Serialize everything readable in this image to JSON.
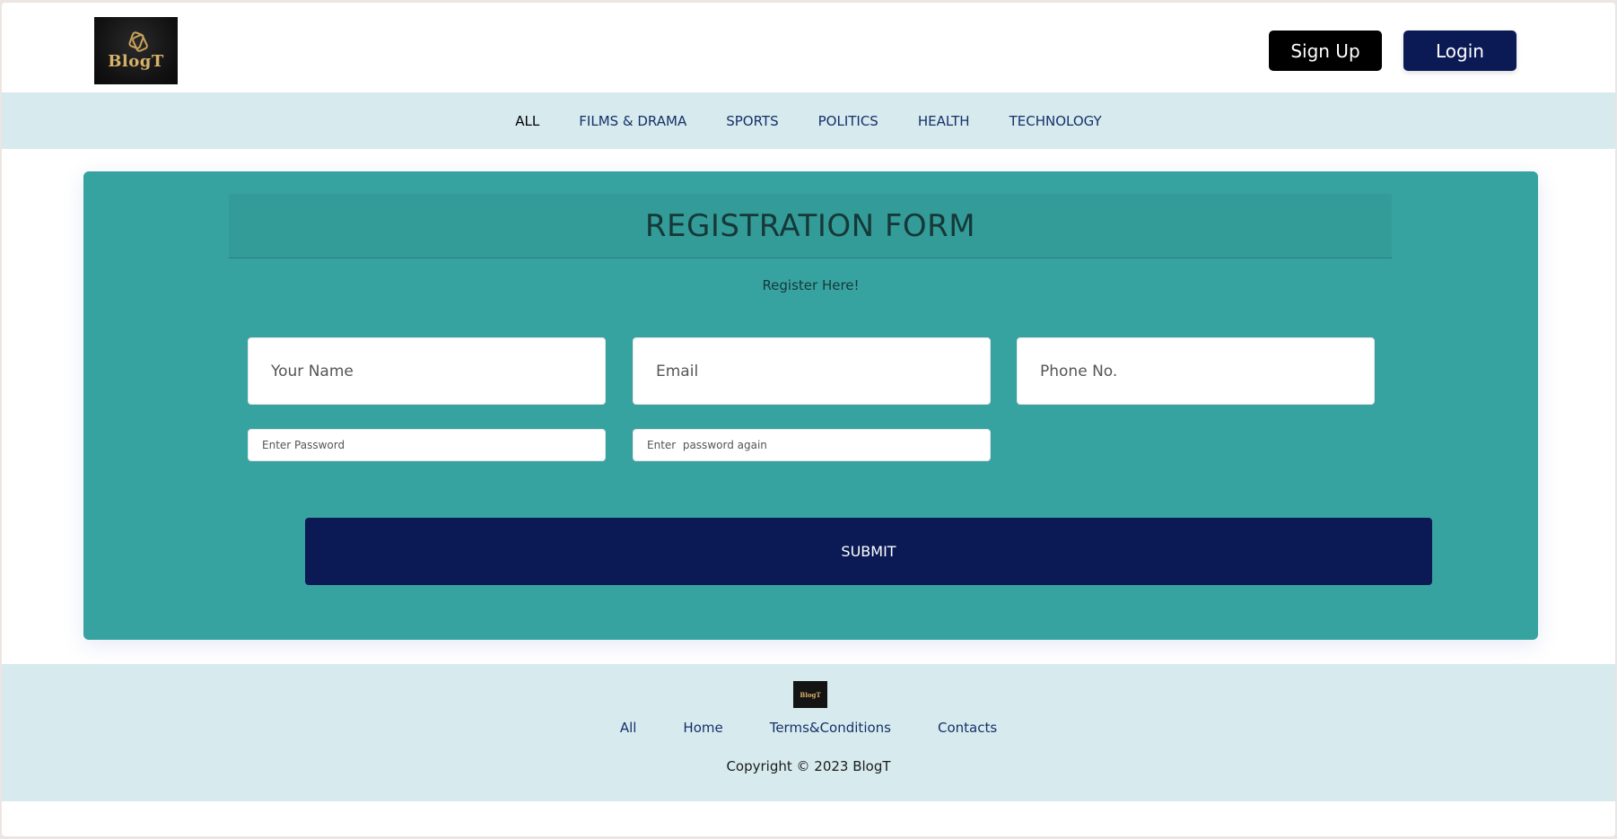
{
  "header": {
    "logo_text": "BlogT",
    "signup_label": "Sign Up",
    "login_label": "Login"
  },
  "nav": {
    "items": [
      {
        "label": "ALL",
        "active": true
      },
      {
        "label": "FILMS & DRAMA",
        "active": false
      },
      {
        "label": "SPORTS",
        "active": false
      },
      {
        "label": "POLITICS",
        "active": false
      },
      {
        "label": "HEALTH",
        "active": false
      },
      {
        "label": "TECHNOLOGY",
        "active": false
      }
    ]
  },
  "form": {
    "title": "REGISTRATION FORM",
    "subtitle": "Register Here!",
    "fields": {
      "name": {
        "placeholder": "Your Name",
        "value": ""
      },
      "email": {
        "placeholder": "Email",
        "value": ""
      },
      "phone": {
        "placeholder": "Phone No.",
        "value": ""
      },
      "password": {
        "placeholder": "Enter Password",
        "value": ""
      },
      "password_again": {
        "placeholder": "Enter  password again",
        "value": ""
      }
    },
    "submit_label": "SUBMIT"
  },
  "footer": {
    "logo_text": "BlogT",
    "links": [
      "All",
      "Home",
      "Terms&Conditions",
      "Contacts"
    ],
    "copyright": "Copyright © 2023 BlogT"
  },
  "colors": {
    "card_bg": "#37a3a0",
    "nav_bg": "#d7ebee",
    "primary_dark": "#0b1a54"
  }
}
